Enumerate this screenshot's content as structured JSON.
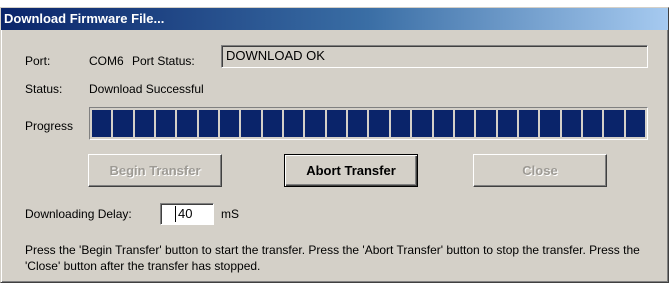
{
  "window": {
    "title": "Download Firmware File..."
  },
  "port": {
    "label": "Port:",
    "value": "COM6",
    "status_label": "Port Status:",
    "status_value": "DOWNLOAD OK"
  },
  "status": {
    "label": "Status:",
    "value": "Download Successful"
  },
  "progress": {
    "label": "Progress",
    "fraction": 1.0,
    "segments": 26,
    "fill_color": "#0a246a"
  },
  "buttons": {
    "begin": "Begin Transfer",
    "abort": "Abort Transfer",
    "close": "Close"
  },
  "delay": {
    "label": "Downloading Delay:",
    "value": "40",
    "unit": "mS"
  },
  "help_text": "Press the 'Begin Transfer' button to start the transfer.  Press the 'Abort Transfer' button to stop the transfer.  Press the 'Close' button after the transfer has stopped."
}
